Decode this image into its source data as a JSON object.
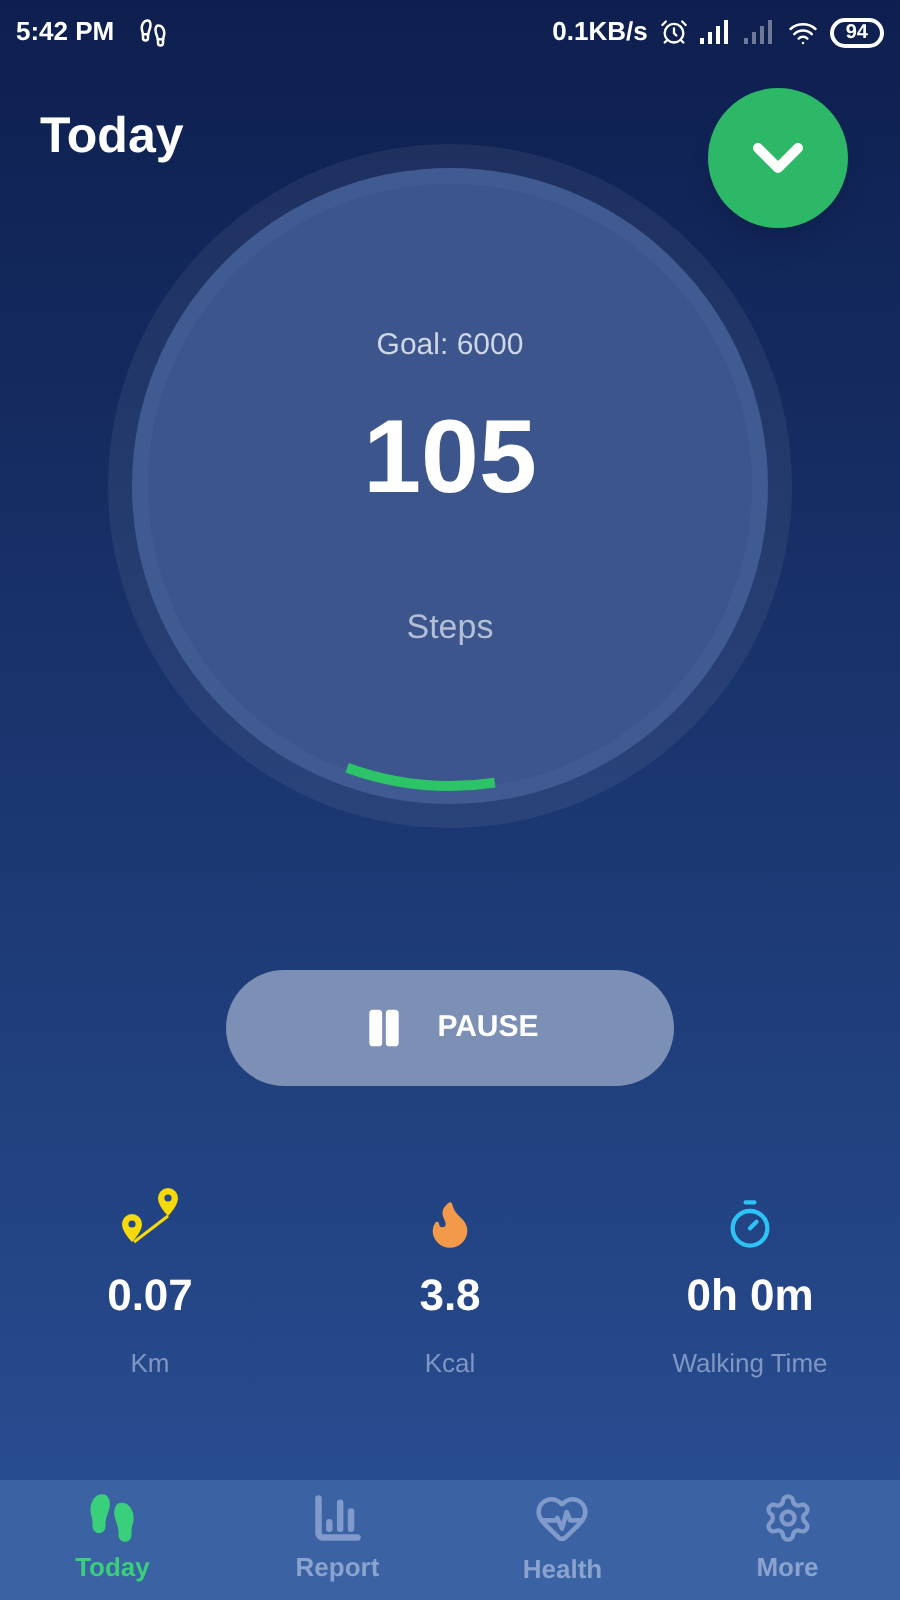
{
  "status_bar": {
    "time": "5:42 PM",
    "speed": "0.1KB/s",
    "battery": "94"
  },
  "header": {
    "title": "Today"
  },
  "ring": {
    "goal": "Goal: 6000",
    "steps": "105",
    "unit": "Steps"
  },
  "pause_button": {
    "label": "PAUSE"
  },
  "stats": [
    {
      "kind": "distance",
      "value": "0.07",
      "label": "Km"
    },
    {
      "kind": "calories",
      "value": "3.8",
      "label": "Kcal"
    },
    {
      "kind": "time",
      "value": "0h 0m",
      "label": "Walking Time"
    }
  ],
  "nav": [
    {
      "kind": "today",
      "label": "Today",
      "selected": true
    },
    {
      "kind": "report",
      "label": "Report",
      "selected": false
    },
    {
      "kind": "health",
      "label": "Health",
      "selected": false
    },
    {
      "kind": "more",
      "label": "More",
      "selected": false
    }
  ]
}
